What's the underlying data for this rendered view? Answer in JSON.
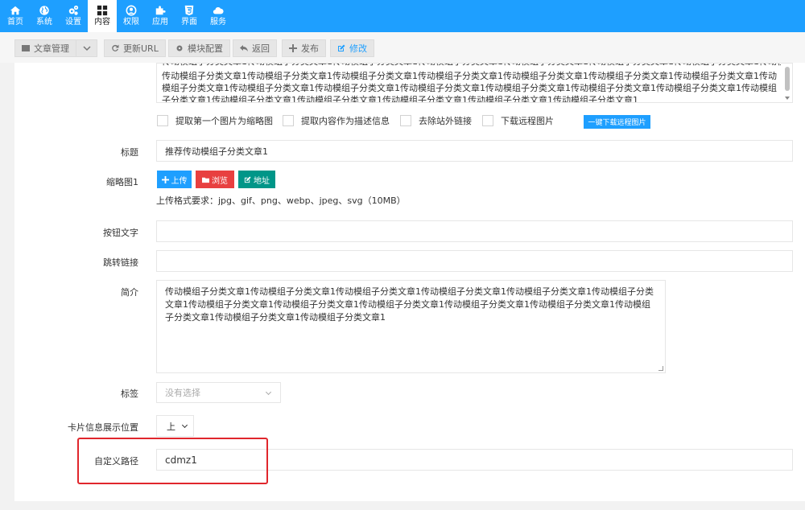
{
  "topnav": {
    "items": [
      {
        "label": "首页",
        "icon": "home-icon"
      },
      {
        "label": "系统",
        "icon": "globe-icon"
      },
      {
        "label": "设置",
        "icon": "cogs-icon"
      },
      {
        "label": "内容",
        "icon": "grid-icon",
        "active": true
      },
      {
        "label": "权限",
        "icon": "user-circle-icon"
      },
      {
        "label": "应用",
        "icon": "puzzle-icon"
      },
      {
        "label": "界面",
        "icon": "html5-icon"
      },
      {
        "label": "服务",
        "icon": "cloud-icon"
      }
    ],
    "bg_color": "#1E9FFF"
  },
  "toolbar": {
    "article_manage": "文章管理",
    "refresh_url": "更新URL",
    "module_config": "模块配置",
    "back": "返回",
    "publish": "发布",
    "edit": "修改"
  },
  "content": {
    "text": "传动模组子分类文章1传动模组子分类文章1传动模组子分类文章1传动模组子分类文章1传动模组子分类文章1传动模组子分类文章1传动模组子分类文章1传动模组子分类文章1传动模组子分类文章1传动模组子分类文章1传动模组子分类文章1传动模组子分类文章1传动模组子分类文章1传动模组子分类文章1传动模组子分类文章1传动模组子分类文章1传动模组子分类文章1传动模组子分类文章1传动模组子分类文章1传动模组子分类文章1"
  },
  "options": {
    "extract_thumb": "提取第一个图片为缩略图",
    "extract_desc": "提取内容作为描述信息",
    "remove_links": "去除站外链接",
    "download_remote": "下载远程图片",
    "one_click_download": "一键下载远程图片"
  },
  "form": {
    "title_label": "标题",
    "title_value": "推荐传动模组子分类文章1",
    "thumb_label": "缩略图1",
    "upload_btn": "上传",
    "browse_btn": "浏览",
    "address_btn": "地址",
    "upload_hint": "上传格式要求：jpg、gif、png、webp、jpeg、svg（10MB）",
    "button_text_label": "按钮文字",
    "button_text_value": "",
    "jump_link_label": "跳转链接",
    "jump_link_value": "",
    "summary_label": "简介",
    "summary_value": "传动模组子分类文章1传动模组子分类文章1传动模组子分类文章1传动模组子分类文章1传动模组子分类文章1传动模组子分类文章1传动模组子分类文章1传动模组子分类文章1传动模组子分类文章1传动模组子分类文章1传动模组子分类文章1传动模组子分类文章1传动模组子分类文章1传动模组子分类文章1",
    "tags_label": "标签",
    "tags_placeholder": "没有选择",
    "card_position_label": "卡片信息展示位置",
    "card_position_value": "上",
    "custom_path_label": "自定义路径",
    "custom_path_value": "cdmz1"
  },
  "colors": {
    "primary": "#1E9FFF",
    "browse": "#FF5722",
    "address": "#009688",
    "highlight": "#e0262c"
  }
}
